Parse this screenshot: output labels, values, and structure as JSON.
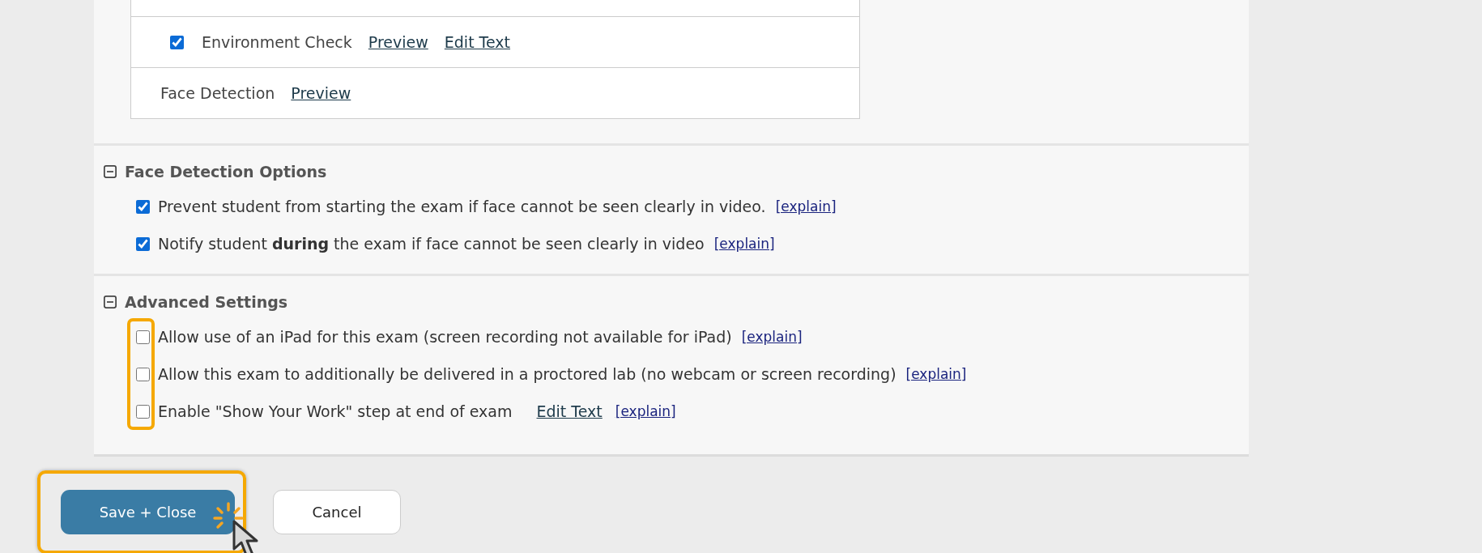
{
  "checks_table": {
    "rows": [
      {
        "kind": "cut"
      },
      {
        "kind": "check",
        "checked": true,
        "label": "Environment Check",
        "links": [
          "Preview",
          "Edit Text"
        ]
      },
      {
        "kind": "plain",
        "label": "Face Detection",
        "links": [
          "Preview"
        ]
      }
    ]
  },
  "sections": [
    {
      "title": "Face Detection Options",
      "expanded": true,
      "highlighted": false,
      "options": [
        {
          "checked": true,
          "text": "Prevent student from starting the exam if face cannot be seen clearly in video.",
          "links": [
            {
              "kind": "explain",
              "text": "[explain]"
            }
          ]
        },
        {
          "checked": true,
          "text": "Notify student **during** the exam if face cannot be seen clearly in video",
          "links": [
            {
              "kind": "explain",
              "text": "[explain]"
            }
          ]
        }
      ]
    },
    {
      "title": "Advanced Settings",
      "expanded": true,
      "highlighted": true,
      "options": [
        {
          "checked": false,
          "text": "Allow use of an iPad for this exam (screen recording not available for iPad)",
          "links": [
            {
              "kind": "explain",
              "text": "[explain]"
            }
          ]
        },
        {
          "checked": false,
          "text": "Allow this exam to additionally be delivered in a proctored lab (no webcam or screen recording)",
          "links": [
            {
              "kind": "explain",
              "text": "[explain]"
            }
          ]
        },
        {
          "checked": false,
          "text": "Enable \"Show Your Work\" step at end of exam",
          "links": [
            {
              "kind": "edit",
              "text": "Edit Text"
            },
            {
              "kind": "explain",
              "text": "[explain]"
            }
          ]
        }
      ]
    }
  ],
  "buttons": [
    {
      "label": "Save + Close",
      "kind": "primary",
      "highlighted": true
    },
    {
      "label": "Cancel",
      "kind": "secondary",
      "highlighted": false
    }
  ]
}
